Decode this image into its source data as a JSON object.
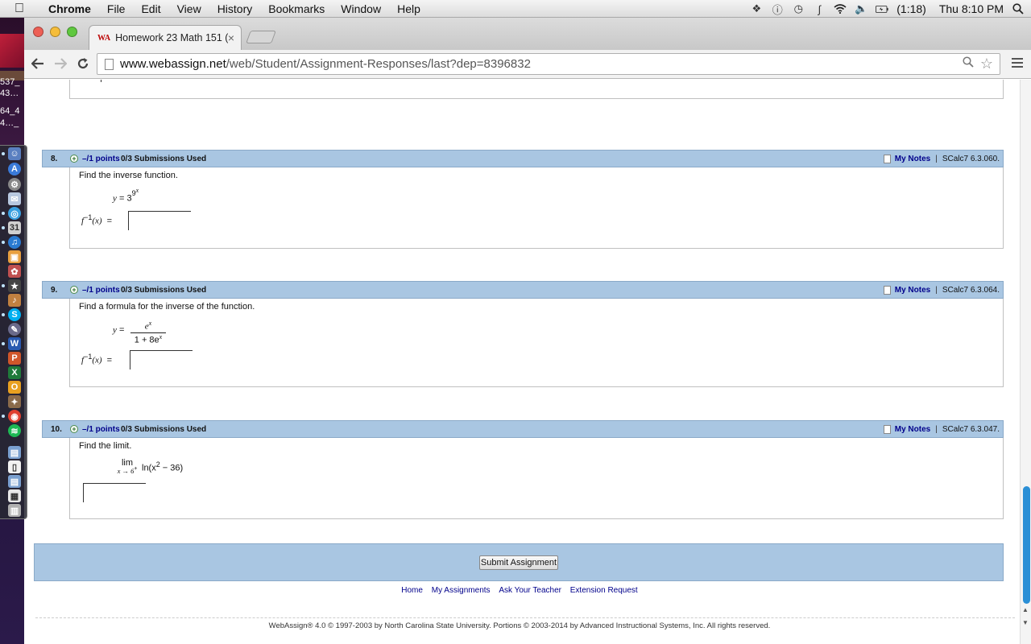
{
  "menubar": {
    "app_name": "Chrome",
    "items": [
      "File",
      "Edit",
      "View",
      "History",
      "Bookmarks",
      "Window",
      "Help"
    ],
    "battery": "(1:18)",
    "clock": "Thu 8:10 PM"
  },
  "desktop": {
    "files": [
      "537_",
      "43…",
      "64_4",
      "4…_"
    ]
  },
  "browser": {
    "tab_title": "Homework 23 Math 151 (S",
    "favicon": "WA",
    "url_domain": "www.webassign.net",
    "url_path": "/web/Student/Assignment-Responses/last?dep=8396832"
  },
  "questions": [
    {
      "number": "8.",
      "points": "–/1 points",
      "submissions": "0/3 Submissions Used",
      "notes": "My Notes",
      "ref": "SCalc7 6.3.060.",
      "prompt": "Find the inverse function.",
      "eq_lhs": "y",
      "eq_base": "3",
      "eq_exp_base": "9",
      "eq_exp_exp": "x",
      "answer_label": "f",
      "answer_sup": "−1",
      "answer_arg": "(x)"
    },
    {
      "number": "9.",
      "points": "–/1 points",
      "submissions": "0/3 Submissions Used",
      "notes": "My Notes",
      "ref": "SCalc7 6.3.064.",
      "prompt": "Find a formula for the inverse of the function.",
      "eq_lhs": "y",
      "frac_num_base": "e",
      "frac_num_exp": "x",
      "frac_den": "1 + 8e",
      "frac_den_exp": "x",
      "answer_label": "f",
      "answer_sup": "−1",
      "answer_arg": "(x)"
    },
    {
      "number": "10.",
      "points": "–/1 points",
      "submissions": "0/3 Submissions Used",
      "notes": "My Notes",
      "ref": "SCalc7 6.3.047.",
      "prompt": "Find the limit.",
      "lim_word": "lim",
      "lim_sub": "x → 6",
      "lim_sub_sup": "+",
      "lim_expr": "ln(x",
      "lim_expr_exp": "2",
      "lim_expr_tail": " − 36)"
    }
  ],
  "submit_label": "Submit Assignment",
  "footer": {
    "links": [
      "Home",
      "My Assignments",
      "Ask Your Teacher",
      "Extension Request"
    ],
    "copyright": "WebAssign® 4.0 © 1997-2003 by North Carolina State University. Portions © 2003-2014 by Advanced Instructional Systems, Inc. All rights reserved."
  }
}
